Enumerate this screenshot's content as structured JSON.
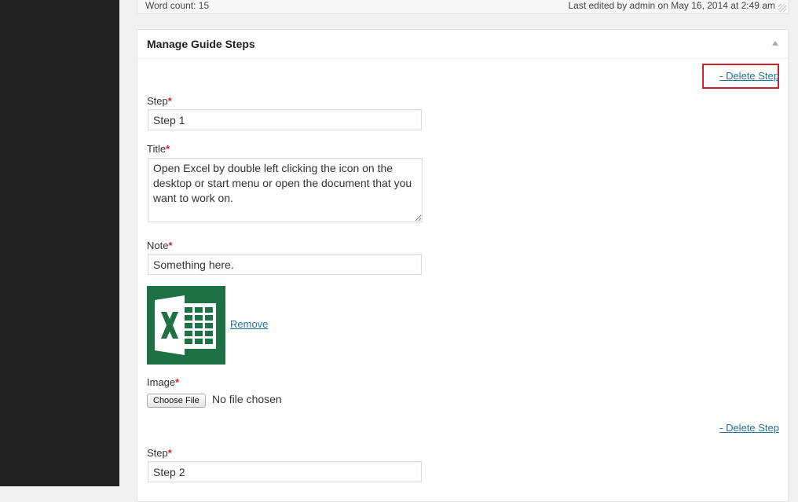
{
  "status": {
    "word_count": "Word count: 15",
    "last_edited": "Last edited by admin on May 16, 2014 at 2:49 am"
  },
  "metabox": {
    "title": "Manage Guide Steps"
  },
  "steps": [
    {
      "delete_label": "- Delete Step",
      "step_label": "Step",
      "step_value": "Step 1",
      "title_label": "Title",
      "title_value": "Open Excel by double left clicking the icon on the desktop or start menu or open the document that you want to work on.",
      "note_label": "Note",
      "note_value": "Something here.",
      "image_icon": "excel-icon",
      "remove_label": "Remove",
      "image_label": "Image",
      "choose_file_label": "Choose File",
      "no_file_text": "No file chosen"
    },
    {
      "delete_label": "- Delete Step",
      "step_label": "Step",
      "step_value": "Step 2"
    }
  ],
  "required_mark": "*",
  "colors": {
    "sidebar": "#222222",
    "link": "#21759b",
    "required": "#d0202e",
    "highlight": "#d0202e",
    "excel_green": "#1e7145"
  }
}
